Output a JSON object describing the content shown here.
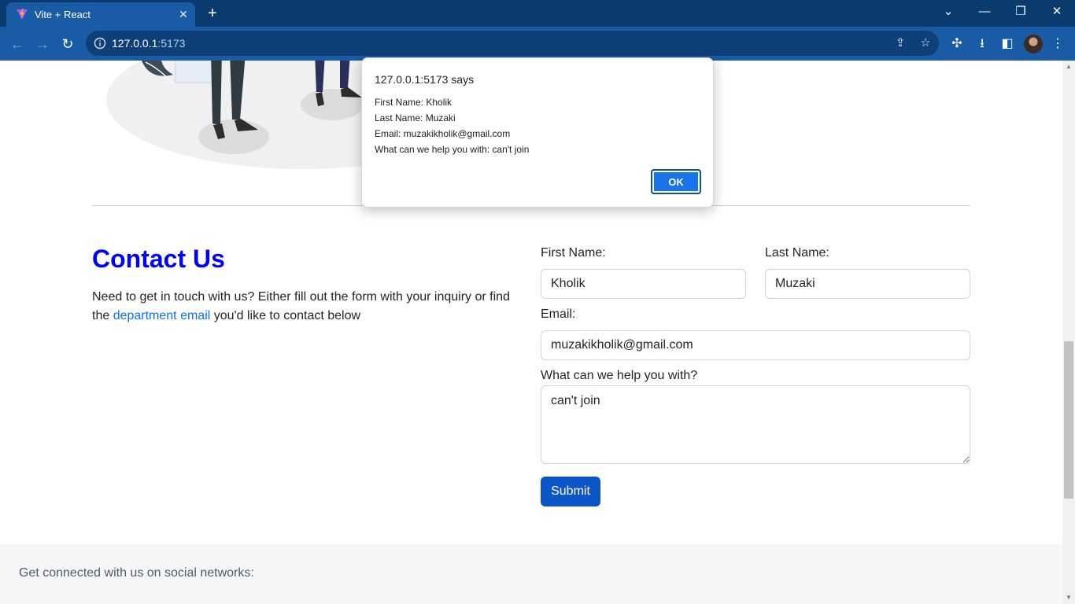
{
  "browser": {
    "tab_title": "Vite + React",
    "tab_close": "✕",
    "new_tab": "+",
    "url_host": "127.0.0.1",
    "url_port": ":5173",
    "window_minimize": "—",
    "window_restore": "❐",
    "window_close": "✕",
    "tab_search": "⌄"
  },
  "contact": {
    "title": "Contact Us",
    "text_before_link": "Need to get in touch with us? Either fill out the form with your inquiry or find the ",
    "link_text": "department email",
    "text_after_link": " you'd like to contact below"
  },
  "form": {
    "first_name_label": "First Name:",
    "first_name_value": "Kholik",
    "last_name_label": "Last Name:",
    "last_name_value": "Muzaki",
    "email_label": "Email:",
    "email_value": "muzakikholik@gmail.com",
    "help_label": "What can we help you with?",
    "help_value": "can't join",
    "submit_label": "Submit"
  },
  "footer": {
    "text": "Get connected with us on social networks:"
  },
  "dialog": {
    "title": "127.0.0.1:5173 says",
    "lines": [
      "First Name: Kholik",
      "Last Name: Muzaki",
      "Email: muzakikholik@gmail.com",
      "What can we help you with: can't join"
    ],
    "ok_label": "OK"
  },
  "colors": {
    "accent": "#1a73e8",
    "title_blue": "#0000ff",
    "link_blue": "#0d6efd",
    "button_blue": "#0d56c8",
    "chrome_dark": "#0b3a6e",
    "chrome_toolbar": "#1a5ba6"
  }
}
